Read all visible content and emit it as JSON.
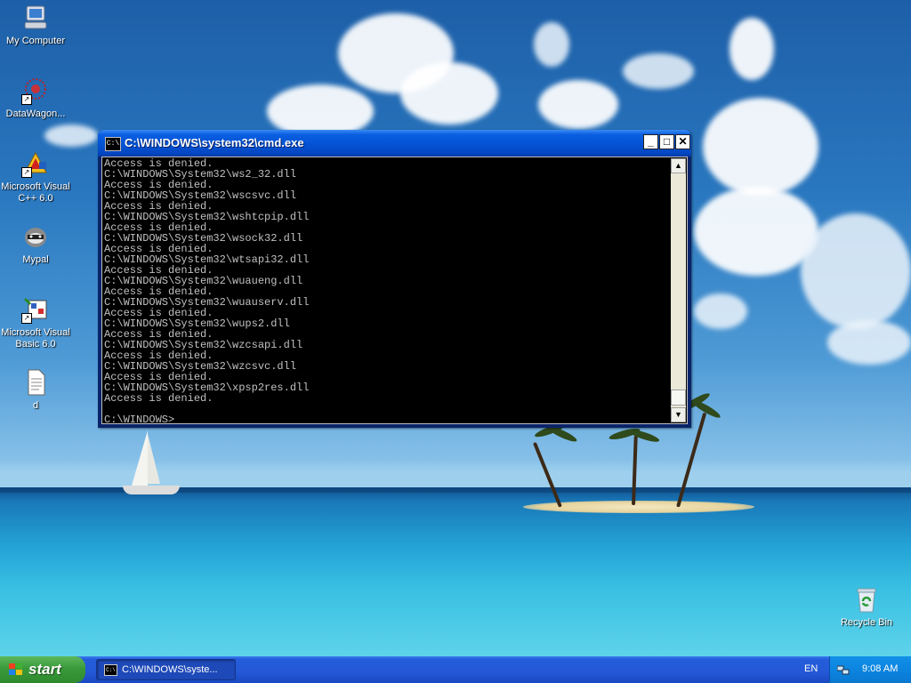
{
  "desktop": {
    "icons": [
      {
        "label": "My Computer",
        "icon": "my-computer-icon"
      },
      {
        "label": "DataWagon...",
        "icon": "datawagon-icon"
      },
      {
        "label": "Microsoft Visual C++ 6.0",
        "icon": "visual-cpp-icon"
      },
      {
        "label": "Mypal",
        "icon": "mypal-icon"
      },
      {
        "label": "Microsoft Visual Basic 6.0",
        "icon": "visual-basic-icon"
      },
      {
        "label": "d",
        "icon": "text-document-icon"
      },
      {
        "label": "Recycle Bin",
        "icon": "recycle-bin-icon"
      }
    ]
  },
  "window": {
    "title": "C:\\WINDOWS\\system32\\cmd.exe",
    "icon_text": "C:\\",
    "buttons": {
      "minimize": "_",
      "maximize": "□",
      "close": "✕"
    },
    "console_lines": [
      "Access is denied.",
      "C:\\WINDOWS\\System32\\ws2_32.dll",
      "Access is denied.",
      "C:\\WINDOWS\\System32\\wscsvc.dll",
      "Access is denied.",
      "C:\\WINDOWS\\System32\\wshtcpip.dll",
      "Access is denied.",
      "C:\\WINDOWS\\System32\\wsock32.dll",
      "Access is denied.",
      "C:\\WINDOWS\\System32\\wtsapi32.dll",
      "Access is denied.",
      "C:\\WINDOWS\\System32\\wuaueng.dll",
      "Access is denied.",
      "C:\\WINDOWS\\System32\\wuauserv.dll",
      "Access is denied.",
      "C:\\WINDOWS\\System32\\wups2.dll",
      "Access is denied.",
      "C:\\WINDOWS\\System32\\wzcsapi.dll",
      "Access is denied.",
      "C:\\WINDOWS\\System32\\wzcsvc.dll",
      "Access is denied.",
      "C:\\WINDOWS\\System32\\xpsp2res.dll",
      "Access is denied.",
      "",
      "C:\\WINDOWS>"
    ],
    "scroll_up": "▲",
    "scroll_down": "▼"
  },
  "taskbar": {
    "start_label": "start",
    "task_label": "C:\\WINDOWS\\syste...",
    "language": "EN",
    "clock": "9:08 AM"
  },
  "colors": {
    "console_bg": "#000000",
    "console_fg": "#c0c0c0",
    "titlebar": "#0454d6",
    "taskbar": "#245edb",
    "start": "#3a9a3a"
  }
}
